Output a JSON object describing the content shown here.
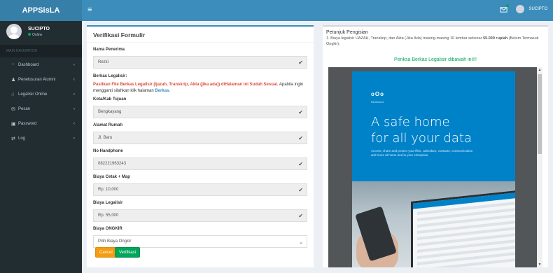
{
  "app": {
    "title": "APPSisLA"
  },
  "header": {
    "menu_icon": "hamburger-icon",
    "notif_icon": "envelope-icon",
    "user_name": "SUCIPTO"
  },
  "sidebar": {
    "user_name": "SUCIPTO",
    "status": "Online",
    "section": "MAIN NAVIGATION",
    "items": [
      {
        "label": "Dashboard",
        "icon": "dashboard-icon"
      },
      {
        "label": "Penelusuran Alumni",
        "icon": "user-icon"
      },
      {
        "label": "Legalisir Online",
        "icon": "thumbs-up-icon"
      },
      {
        "label": "Pesan",
        "icon": "envelope-icon"
      },
      {
        "label": "Password",
        "icon": "lock-icon"
      },
      {
        "label": "Log",
        "icon": "random-icon"
      }
    ]
  },
  "form": {
    "title": "Verifikasi Formulir",
    "nama_label": "Nama Penerima",
    "nama_value": "Rezki",
    "legal_label": "Berkas Legalisir:",
    "legal_warn": "Pastikan File Berkas Legalisir (Ijazah, Transkrip, Akta (jika ada)) diHalaman ini Sudah Sesuai.",
    "legal_rest": " Apabila ingin mengganti silahkan klik halaman ",
    "legal_link": "Berkas",
    "legal_end": ".",
    "kota_label": "Kota/Kab Tujuan",
    "kota_value": "Bengkayang",
    "alamat_label": "Alamat Rumah",
    "alamat_value": "Jl. Baru",
    "hp_label": "No Handphone",
    "hp_value": "082221963243",
    "cetak_label": "Biaya Cetak + Map",
    "cetak_value": "Rp. 10,000",
    "legalisir_label": "Biaya Legalisir",
    "legalisir_value": "Rp. 55,000",
    "ongkir_label": "Biaya ONGKIR",
    "ongkir_value": "Pilih Biaya Ongkir",
    "cancel_label": "Cancel",
    "verify_label": "Verifikasi"
  },
  "petunjuk": {
    "title": "Petunjuk Pengisian",
    "text_a": "1. Biaya legalisir IJAZAH, Transkrip, dan Akta (Jika Ada) masing-masing 10 lembar sebesar ",
    "text_bold": "55.000 rupiah",
    "text_b": " (Belum Termasuk Ongkir).",
    "periksa": "Periksa Berkas Legalisir dibawah ini!!!"
  },
  "document": {
    "logo_text": "oOo",
    "logo_sub": "Nextcloud",
    "headline_1": "A safe home",
    "headline_2": "for all your data",
    "desc": "Access, share and protect your files, calendars, contacts, communication and more at home and in your enterprise."
  }
}
